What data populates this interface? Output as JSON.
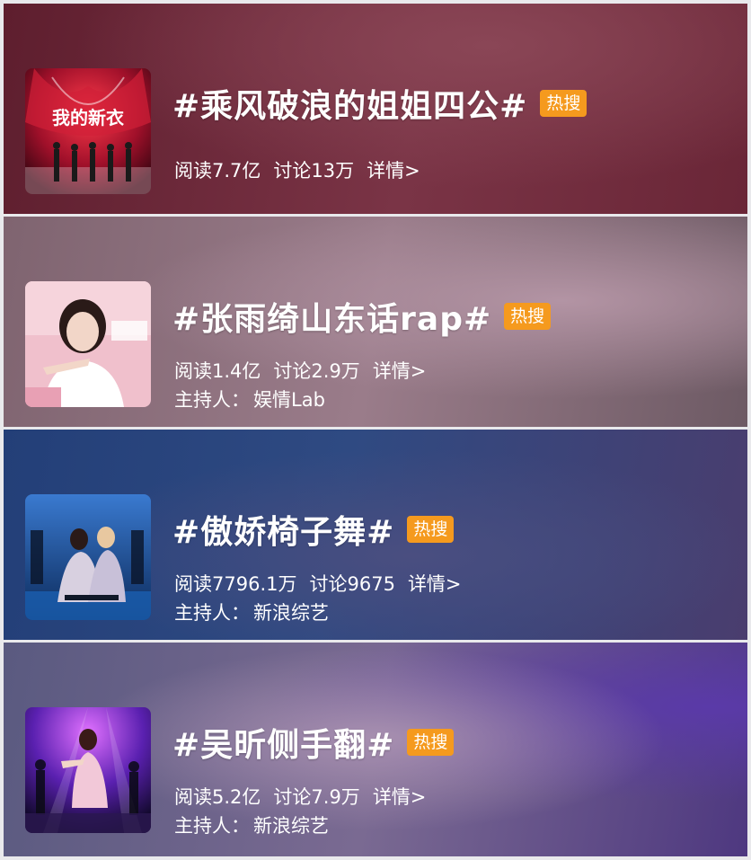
{
  "badge_label": "热搜",
  "colors": {
    "badge": "#f59a1e",
    "text": "#ffffff"
  },
  "topics": [
    {
      "title": "#乘风破浪的姐姐四公#",
      "thumb_text": "我的新衣",
      "reads": "阅读7.7亿",
      "discussions": "讨论13万",
      "details": "详情>",
      "host_label": "",
      "host_name": "",
      "bg_colors": [
        "#5e1e2e",
        "#8a4656",
        "#6a2637"
      ]
    },
    {
      "title": "#张雨绮山东话rap#",
      "thumb_text": "",
      "reads": "阅读1.4亿",
      "discussions": "讨论2.9万",
      "details": "详情>",
      "host_label": "主持人：",
      "host_name": "娱情Lab",
      "bg_colors": [
        "#7f6470",
        "#a68796",
        "#6d5a64"
      ]
    },
    {
      "title": "#傲娇椅子舞#",
      "thumb_text": "",
      "reads": "阅读7796.1万",
      "discussions": "讨论9675",
      "details": "详情>",
      "host_label": "主持人：",
      "host_name": "新浪综艺",
      "bg_colors": [
        "#233f78",
        "#3a4f86",
        "#4a3d6e"
      ]
    },
    {
      "title": "#吴昕侧手翻#",
      "thumb_text": "",
      "reads": "阅读5.2亿",
      "discussions": "讨论7.9万",
      "details": "详情>",
      "host_label": "主持人：",
      "host_name": "新浪综艺",
      "bg_colors": [
        "#5a5a80",
        "#8a7ba2",
        "#4e3880"
      ]
    }
  ]
}
